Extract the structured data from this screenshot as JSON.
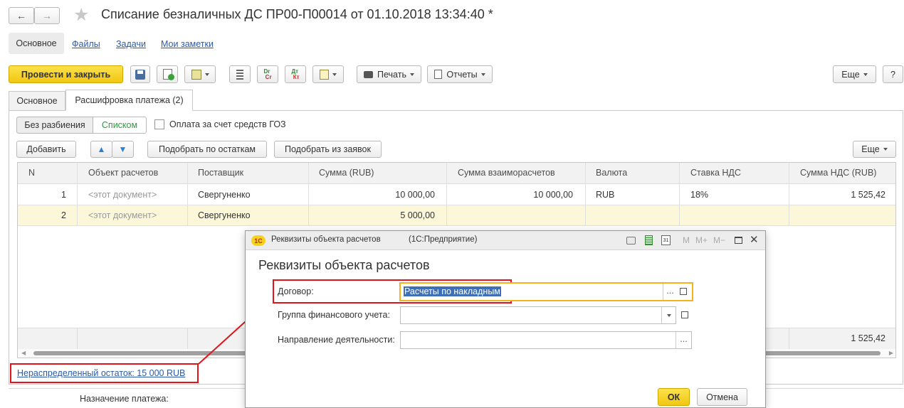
{
  "window": {
    "title": "Списание безналичных ДС ПР00-П00014 от 01.10.2018 13:34:40 *"
  },
  "nav_links": [
    "Основное",
    "Файлы",
    "Задачи",
    "Мои заметки"
  ],
  "toolbar": {
    "post_close": "Провести и закрыть",
    "print": "Печать",
    "reports": "Отчеты",
    "more": "Еще",
    "help": "?"
  },
  "tabs": [
    "Основное",
    "Расшифровка платежа (2)"
  ],
  "mode": {
    "no_split": "Без разбиения",
    "list": "Списком",
    "goz_checkbox": "Оплата за счет средств ГОЗ"
  },
  "table_toolbar": {
    "add": "Добавить",
    "pick_balance": "Подобрать по остаткам",
    "pick_requests": "Подобрать из заявок",
    "more": "Еще"
  },
  "table": {
    "headers": [
      "N",
      "Объект расчетов",
      "Поставщик",
      "Сумма (RUB)",
      "Сумма взаиморасчетов",
      "Валюта",
      "Ставка НДС",
      "Сумма НДС (RUB)"
    ],
    "rows": [
      [
        "1",
        "<этот документ>",
        "Свергуненко",
        "10 000,00",
        "10 000,00",
        "RUB",
        "18%",
        "1 525,42"
      ],
      [
        "2",
        "<этот документ>",
        "Свергуненко",
        "5 000,00",
        "",
        "",
        "",
        ""
      ]
    ],
    "footer_total": "1 525,42"
  },
  "remainder_link": "Нераспределенный остаток: 15 000 RUB",
  "purpose_label": "Назначение платежа:",
  "dialog": {
    "app_title": "Реквизиты объекта расчетов",
    "app_suffix": "(1С:Предприятие)",
    "heading": "Реквизиты объекта расчетов",
    "logo": "1С",
    "mem_buttons": [
      "M",
      "M+",
      "M−"
    ],
    "fields": [
      {
        "label": "Договор:",
        "value": "Расчеты по накладным"
      },
      {
        "label": "Группа финансового учета:",
        "value": ""
      },
      {
        "label": "Направление деятельности:",
        "value": ""
      }
    ],
    "ellipsis": "...",
    "ok": "ОК",
    "cancel": "Отмена"
  },
  "colors": {
    "accent_yellow": "#f7d21c",
    "highlight_red": "#e0141a",
    "selected_row": "#fdf7d9",
    "focus_border": "#f5b21c"
  }
}
